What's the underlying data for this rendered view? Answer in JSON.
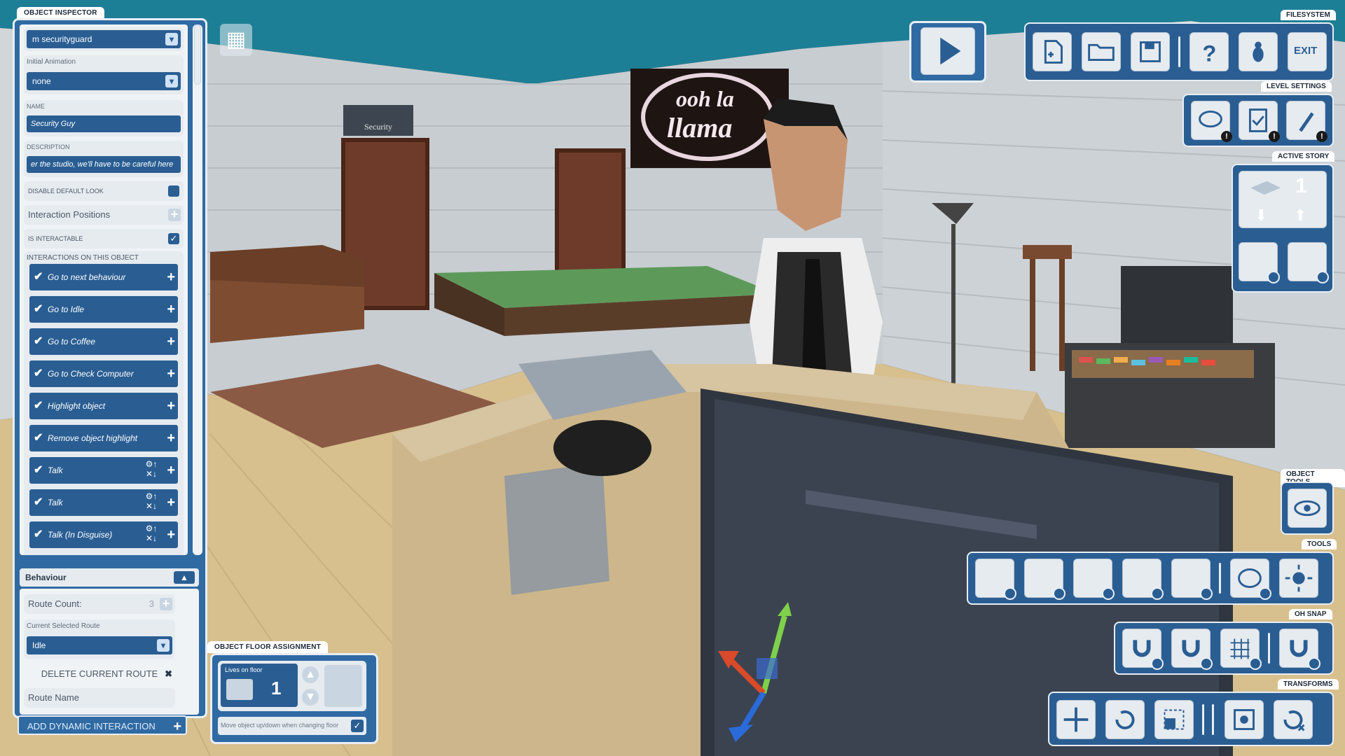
{
  "inspector": {
    "title": "OBJECT INSPECTOR",
    "object_dropdown": "m securityguard",
    "initial_animation_label": "Initial Animation",
    "initial_animation_value": "none",
    "name_label": "NAME",
    "name_value": "Security Guy",
    "description_label": "DESCRIPTION",
    "description_value": "er the studio, we'll have to be careful here",
    "disable_default_look_label": "DISABLE DEFAULT LOOK",
    "interaction_positions_label": "Interaction Positions",
    "is_interactable_label": "IS INTERACTABLE",
    "interactions_header": "INTERACTIONS ON THIS OBJECT",
    "interactions": [
      {
        "label": "Go to next behaviour"
      },
      {
        "label": "Go to Idle"
      },
      {
        "label": "Go to Coffee"
      },
      {
        "label": "Go to Check Computer"
      },
      {
        "label": "Highlight object"
      },
      {
        "label": "Remove object highlight"
      },
      {
        "label": "Talk"
      },
      {
        "label": "Talk"
      },
      {
        "label": "Talk (In Disguise)"
      }
    ],
    "behaviour_header": "Behaviour",
    "route_count_label": "Route Count:",
    "route_count_value": "3",
    "current_route_label": "Current Selected Route",
    "current_route_value": "Idle",
    "delete_route_label": "DELETE CURRENT ROUTE",
    "route_name_label": "Route Name",
    "add_dynamic_label": "ADD DYNAMIC INTERACTION"
  },
  "floor_assign": {
    "title": "OBJECT FLOOR ASSIGNMENT",
    "lives_on_floor_label": "Lives on floor",
    "floor_number": "1",
    "move_with_floor_label": "Move object up/down when changing floor"
  },
  "scene": {
    "sign_line1": "ooh la",
    "sign_line2": "llama",
    "door_sign": "Security"
  },
  "right_panels": {
    "filesystem_title": "FILESYSTEM",
    "exit_label": "EXIT",
    "level_settings_title": "LEVEL SETTINGS",
    "active_story_title": "ACTIVE STORY",
    "active_story_value": "1",
    "object_tools_title": "OBJECT TOOLS",
    "tools_title": "TOOLS",
    "oh_snap_title": "OH SNAP",
    "transforms_title": "TRANSFORMS"
  },
  "colors": {
    "panel_blue": "#2f6aa3",
    "field_blue": "#2a5e93",
    "panel_light": "#e6ebf0",
    "sky": "#1d7f96"
  },
  "icons": [
    "play-icon",
    "new-file-icon",
    "open-folder-icon",
    "save-icon",
    "help-icon",
    "bug-icon",
    "exit-icon",
    "chat-icon",
    "notes-icon",
    "brush-icon",
    "floor-layer-icon",
    "arrow-down-icon",
    "arrow-up-icon",
    "eye-icon",
    "grid-toggle-icon",
    "move-icon",
    "rotate-icon",
    "scale-icon",
    "focus-icon",
    "magnet-icon",
    "paint-palette-icon",
    "sun-icon"
  ]
}
